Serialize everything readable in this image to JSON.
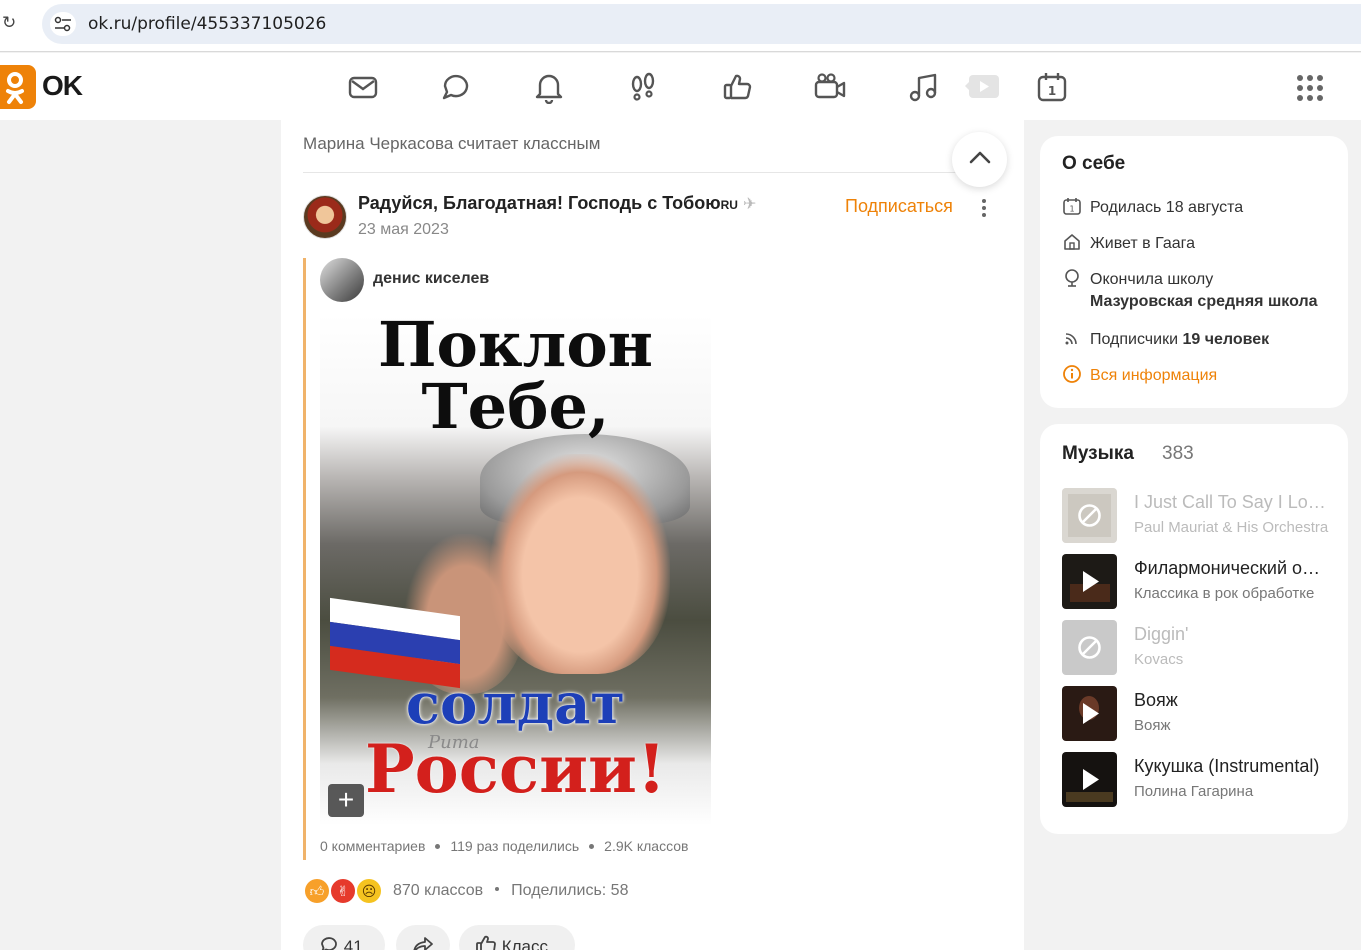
{
  "browser": {
    "url": "ok.ru/profile/455337105026"
  },
  "header": {
    "logo_text": "OK",
    "nav_icons": [
      "mail-icon",
      "chat-icon",
      "bell-icon",
      "footprints-icon",
      "like-icon",
      "video-icon",
      "music-note-icon",
      "video-play-icon",
      "calendar-icon"
    ],
    "accent": "#ee8208"
  },
  "feed": {
    "liked_by": "Марина Черкасова считает классным",
    "group": {
      "name": "Радуйся, Благодатная! Господь с Тобою",
      "name_suffix": "RU",
      "date": "23 мая 2023",
      "subscribe_label": "Подписаться"
    },
    "repost": {
      "author": "денис киселев",
      "image_text": {
        "line1": "Поклон",
        "line2": "Тебе,",
        "line3": "солдат",
        "line4": "России!",
        "watermark": "Рита"
      },
      "stats": {
        "comments": "0 комментариев",
        "shares": "119 раз поделились",
        "classes": "2.9K классов"
      }
    },
    "reactions_summary": {
      "classes": "870 классов",
      "shared": "Поделились: 58"
    },
    "actions": {
      "comments_count": "41",
      "share_label": "",
      "class_label": "Класс"
    }
  },
  "about": {
    "title": "О себе",
    "born": "Родилась 18 августа",
    "lives": "Живет в Гаага",
    "school_label": "Окончила школу",
    "school_name": "Мазуровская средняя школа",
    "followers_label": "Подписчики",
    "followers_value": "19 человек",
    "all_info": "Вся информация"
  },
  "music": {
    "title": "Музыка",
    "count": "383",
    "tracks": [
      {
        "title": "I Just Call To Say I Love You",
        "artist": "Paul Mauriat & His Orchestra",
        "state": "unavailable"
      },
      {
        "title": "Филармонический оркестр",
        "artist": "Классика в рок обработке",
        "state": "playable"
      },
      {
        "title": "Diggin'",
        "artist": "Kovacs",
        "state": "unavailable"
      },
      {
        "title": "Вояж",
        "artist": "Вояж",
        "state": "playable"
      },
      {
        "title": "Кукушка (Instrumental)",
        "artist": "Полина Гагарина",
        "state": "playable"
      }
    ]
  }
}
